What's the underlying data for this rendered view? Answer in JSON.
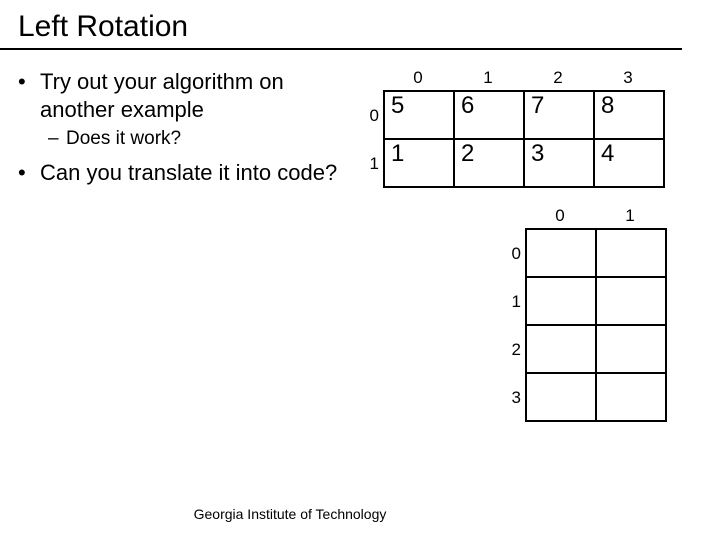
{
  "title": "Left Rotation",
  "bullets": {
    "b1": "Try out your algorithm on another example",
    "sub1": "Does it work?",
    "b2": "Can you translate it into code?"
  },
  "grid1": {
    "col_labels": [
      "0",
      "1",
      "2",
      "3"
    ],
    "row_labels": [
      "0",
      "1"
    ],
    "cells": [
      [
        "5",
        "6",
        "7",
        "8"
      ],
      [
        "1",
        "2",
        "3",
        "4"
      ]
    ]
  },
  "grid2": {
    "col_labels": [
      "0",
      "1"
    ],
    "row_labels": [
      "0",
      "1",
      "2",
      "3"
    ]
  },
  "footer": "Georgia Institute of Technology",
  "chart_data": {
    "type": "table",
    "title": "Left Rotation example grids",
    "tables": [
      {
        "name": "source_2x4",
        "rows": 2,
        "cols": 4,
        "col_headers": [
          0,
          1,
          2,
          3
        ],
        "row_headers": [
          0,
          1
        ],
        "data": [
          [
            5,
            6,
            7,
            8
          ],
          [
            1,
            2,
            3,
            4
          ]
        ]
      },
      {
        "name": "target_4x2",
        "rows": 4,
        "cols": 2,
        "col_headers": [
          0,
          1
        ],
        "row_headers": [
          0,
          1,
          2,
          3
        ],
        "data": [
          [
            null,
            null
          ],
          [
            null,
            null
          ],
          [
            null,
            null
          ],
          [
            null,
            null
          ]
        ]
      }
    ]
  }
}
